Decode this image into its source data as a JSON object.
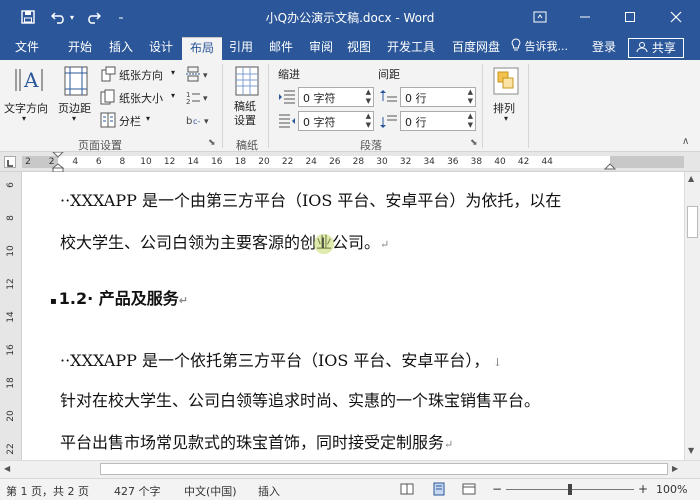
{
  "window": {
    "title": "小Q办公演示文稿.docx - Word",
    "accent": "#2b579a"
  },
  "tabs": [
    {
      "label": "文件"
    },
    {
      "label": "开始"
    },
    {
      "label": "插入"
    },
    {
      "label": "设计"
    },
    {
      "label": "布局"
    },
    {
      "label": "引用"
    },
    {
      "label": "邮件"
    },
    {
      "label": "审阅"
    },
    {
      "label": "视图"
    },
    {
      "label": "开发工具"
    },
    {
      "label": "百度网盘"
    }
  ],
  "active_tab": "布局",
  "tell_me": "告诉我...",
  "login": "登录",
  "share": "共享",
  "ribbon": {
    "page_setup": {
      "label": "页面设置",
      "text_direction": "文字方向",
      "margins": "页边距",
      "orientation": "纸张方向",
      "size": "纸张大小",
      "columns": "分栏"
    },
    "manuscript": {
      "label": "稿纸",
      "button": "稿纸设置"
    },
    "paragraph": {
      "label": "段落",
      "indent_title": "缩进",
      "spacing_title": "间距",
      "indent_left": "0 字符",
      "indent_right": "0 字符",
      "spacing_before": "0 行",
      "spacing_after": "0 行"
    },
    "arrange": {
      "label": "排列"
    }
  },
  "ruler": {
    "marks": [
      "2",
      "2",
      "4",
      "6",
      "8",
      "10",
      "12",
      "14",
      "16",
      "18",
      "20",
      "22",
      "24",
      "26",
      "28",
      "30",
      "32",
      "34",
      "36",
      "38",
      "40",
      "42",
      "44"
    ],
    "vmarks": [
      "6",
      "8",
      "10",
      "12",
      "14",
      "16",
      "18",
      "20",
      "22"
    ]
  },
  "document": {
    "lines": [
      "··XXXAPP 是一个由第三方平台（IOS 平台、安卓平台）为依托，以在",
      "校大学生、公司白领为主要客源的创业公司。",
      "··XXXAPP 是一个依托第三方平台（IOS 平台、安卓平台），",
      "针对在校大学生、公司白领等追求时尚、实惠的一个珠宝销售平台。",
      "平台出售市场常见款式的珠宝首饰，同时接受定制服务"
    ],
    "heading": "1.2· 产品及服务"
  },
  "status": {
    "page": "第 1 页，共 2 页",
    "words": "427 个字",
    "language": "中文(中国)",
    "mode": "插入",
    "zoom": "100%"
  }
}
